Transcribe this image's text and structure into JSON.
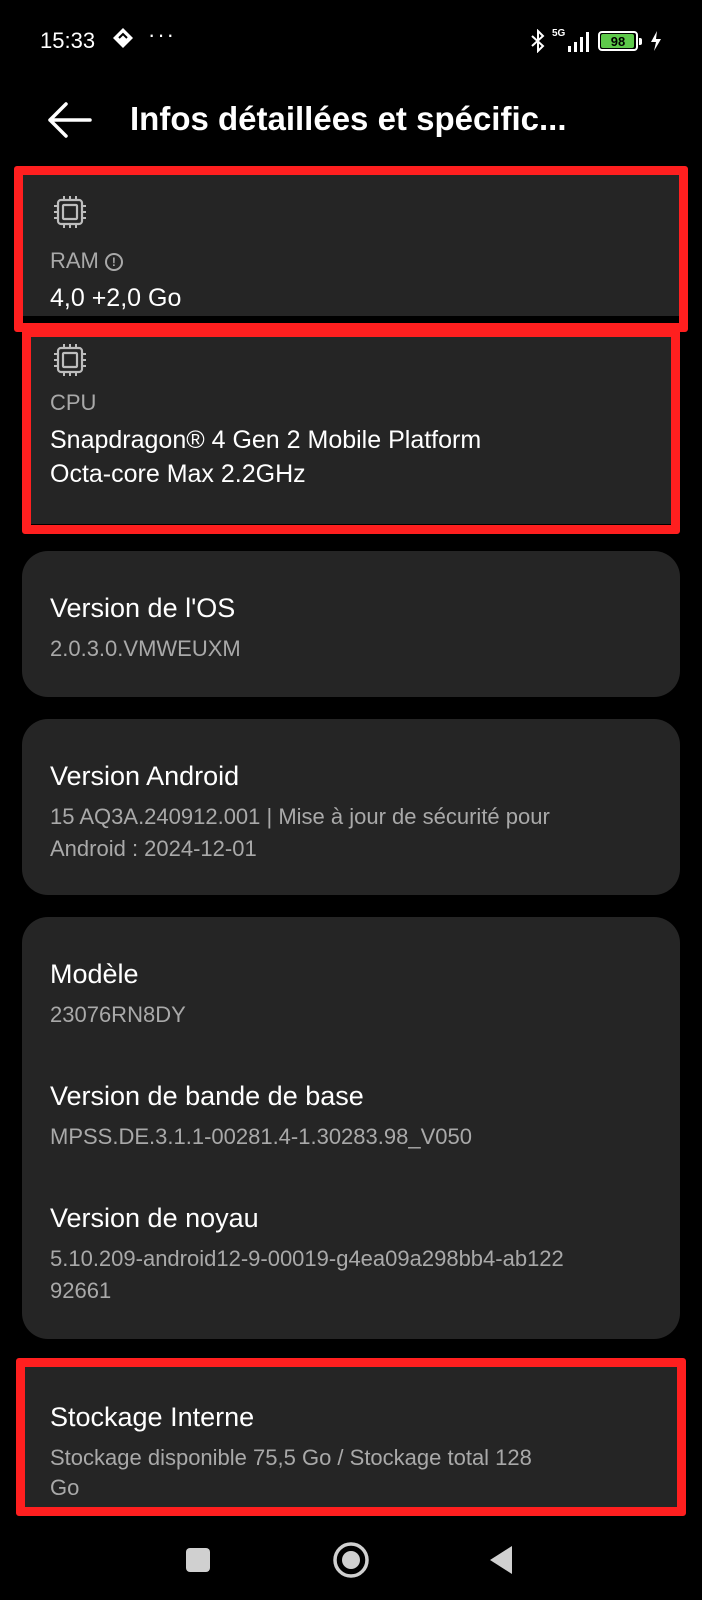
{
  "status_bar": {
    "time": "15:33",
    "network": "5G",
    "battery": "98",
    "battery_level": 0.98
  },
  "header": {
    "title": "Infos détaillées et spécific..."
  },
  "ram": {
    "label": "RAM",
    "value": "4,0 +2,0 Go"
  },
  "cpu": {
    "label": "CPU",
    "value_line1": "Snapdragon® 4 Gen 2 Mobile Platform",
    "value_line2": "Octa-core Max 2.2GHz"
  },
  "os_version": {
    "title": "Version de l'OS",
    "value": "2.0.3.0.VMWEUXM"
  },
  "android_version": {
    "title": "Version Android",
    "value_line1": "15 AQ3A.240912.001 | Mise à jour de sécurité pour",
    "value_line2": "Android : 2024-12-01"
  },
  "model": {
    "title": "Modèle",
    "value": "23076RN8DY"
  },
  "baseband": {
    "title": "Version de bande de base",
    "value": "MPSS.DE.3.1.1-00281.4-1.30283.98_V050"
  },
  "kernel": {
    "title": "Version de noyau",
    "value_line1": "5.10.209-android12-9-00019-g4ea09a298bb4-ab122",
    "value_line2": "92661"
  },
  "storage": {
    "title": "Stockage Interne",
    "value_line1": "Stockage disponible  75,5 Go / Stockage total  128",
    "value_line2": "Go"
  },
  "colors": {
    "background": "#000000",
    "card": "#252525",
    "highlight": "#ff1f1f",
    "secondary_text": "#a9a9a9",
    "battery": "#5ec94b"
  }
}
